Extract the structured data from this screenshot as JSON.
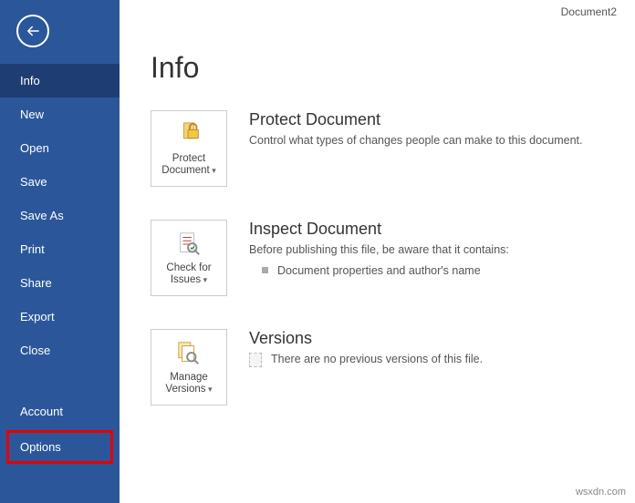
{
  "document_name": "Document2",
  "page_title": "Info",
  "sidebar": {
    "items": [
      {
        "label": "Info",
        "selected": true
      },
      {
        "label": "New"
      },
      {
        "label": "Open"
      },
      {
        "label": "Save"
      },
      {
        "label": "Save As"
      },
      {
        "label": "Print"
      },
      {
        "label": "Share"
      },
      {
        "label": "Export"
      },
      {
        "label": "Close"
      }
    ],
    "account_label": "Account",
    "options_label": "Options"
  },
  "sections": {
    "protect": {
      "tile_label": "Protect Document",
      "heading": "Protect Document",
      "desc": "Control what types of changes people can make to this document."
    },
    "inspect": {
      "tile_label": "Check for Issues",
      "heading": "Inspect Document",
      "desc": "Before publishing this file, be aware that it contains:",
      "bullet": "Document properties and author's name"
    },
    "versions": {
      "tile_label": "Manage Versions",
      "heading": "Versions",
      "desc": "There are no previous versions of this file."
    }
  },
  "watermark": "wsxdn.com"
}
